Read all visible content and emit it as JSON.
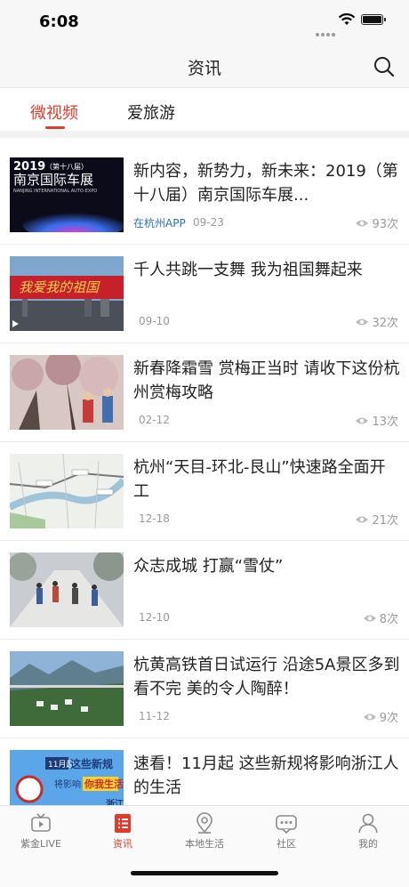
{
  "status_bar": {
    "time": "6:08"
  },
  "header": {
    "title": "资讯",
    "search_icon": "search-icon"
  },
  "tabs": [
    {
      "label": "微视频",
      "active": true
    },
    {
      "label": "爱旅游",
      "active": false
    }
  ],
  "articles": [
    {
      "title": "新内容，新势力，新未来：2019（第十八届）南京国际车展...",
      "source": "在杭州APP",
      "date": "09-23",
      "views": "93次",
      "thumb_text": {
        "year": "2019",
        "sub": "（第十八届）",
        "main": "南京国际车展",
        "en": "NANJING INTERNATIONAL AUTO-EXPO"
      }
    },
    {
      "title": "千人共跳一支舞 我为祖国舞起来",
      "source": "",
      "date": "09-10",
      "views": "32次",
      "thumb_text": {
        "banner": "我爱我的祖国"
      }
    },
    {
      "title": "新春降霜雪 赏梅正当时 请收下这份杭州赏梅攻略",
      "source": "",
      "date": "02-12",
      "views": "13次"
    },
    {
      "title": "杭州“天目-环北-艮山”快速路全面开工",
      "source": "",
      "date": "12-18",
      "views": "21次"
    },
    {
      "title": "众志成城 打赢“雪仗”",
      "source": "",
      "date": "12-10",
      "views": "8次"
    },
    {
      "title": "杭黄高铁首日试运行 沿途5A景区多到看不完 美的令人陶醉！",
      "source": "",
      "date": "11-12",
      "views": "9次"
    },
    {
      "title": "速看！11月起 这些新规将影响浙江人的生活",
      "source": "",
      "date": "",
      "views": "",
      "thumb_text": {
        "line1": "11月起",
        "line2": "这些新规",
        "line3": "将影响",
        "line4": "你我生活",
        "corner": "浙江"
      }
    }
  ],
  "tabbar": [
    {
      "label": "紫金LIVE",
      "icon": "tv-icon",
      "active": false
    },
    {
      "label": "资讯",
      "icon": "news-list-icon",
      "active": true
    },
    {
      "label": "本地生活",
      "icon": "location-pin-icon",
      "active": false
    },
    {
      "label": "社区",
      "icon": "chat-bubble-icon",
      "active": false
    },
    {
      "label": "我的",
      "icon": "person-icon",
      "active": false
    }
  ],
  "colors": {
    "accent": "#e23b2b",
    "link": "#2d6fb7",
    "muted": "#999999"
  }
}
